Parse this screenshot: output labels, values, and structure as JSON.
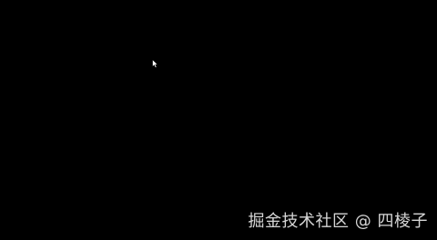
{
  "screen": {
    "background": "#000000"
  },
  "cursor": {
    "icon": "mouse-pointer-icon",
    "color": "#ffffff"
  },
  "watermark": {
    "text": "掘金技术社区 @ 四棱子",
    "color": "#e8e8e8"
  }
}
